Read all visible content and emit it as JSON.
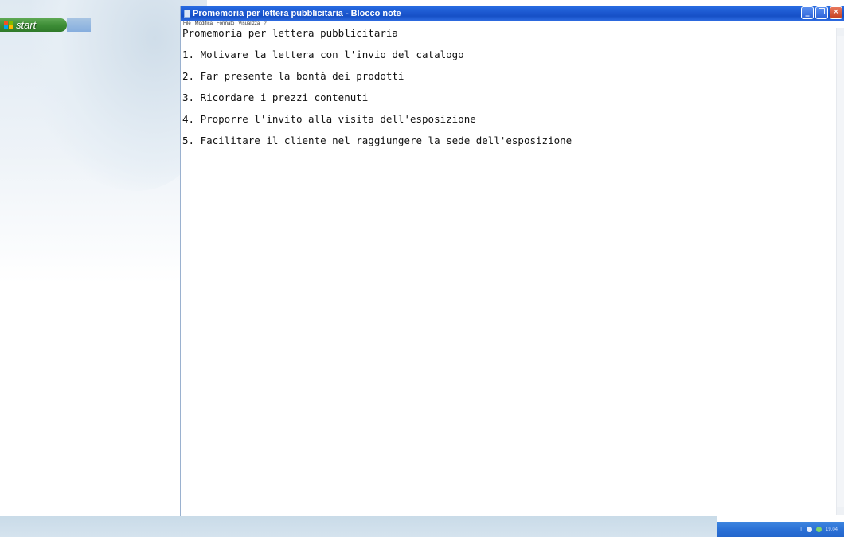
{
  "desktop": {
    "start_label": "start"
  },
  "window": {
    "title": "Promemoria per lettera pubblicitaria - Blocco note",
    "controls": {
      "minimize": "_",
      "restore": "❐",
      "close": "✕"
    }
  },
  "menu": {
    "items": [
      "File",
      "Modifica",
      "Formato",
      "Visualizza",
      "?"
    ]
  },
  "document": {
    "lines": [
      "Promemoria per lettera pubblicitaria",
      "1. Motivare la lettera con l'invio del catalogo",
      "2. Far presente la bontà dei prodotti",
      "3. Ricordare i prezzi contenuti",
      "4. Proporre l'invito alla visita dell'esposizione",
      "5. Facilitare il cliente nel raggiungere la sede dell'esposizione"
    ]
  },
  "tray": {
    "language": "IT",
    "clock": "19.04"
  },
  "colors": {
    "titlebar": "#1c58d0",
    "start_button": "#3e8e37",
    "close_button": "#c43f1f",
    "tray": "#2b71d6"
  },
  "icons": {
    "windows_logo": "windows-logo-icon",
    "notepad": "notepad-icon",
    "network": "network-icon",
    "volume": "volume-icon"
  }
}
